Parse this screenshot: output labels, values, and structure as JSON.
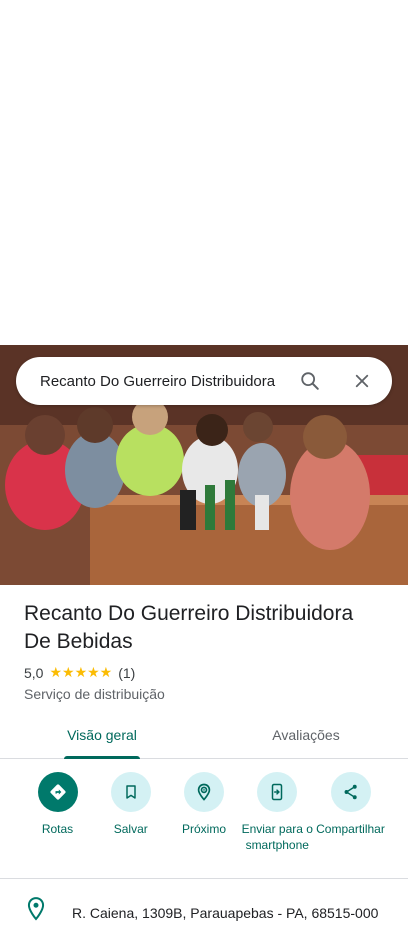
{
  "search": {
    "query": "Recanto Do Guerreiro Distribuidora"
  },
  "place": {
    "name": "Recanto Do Guerreiro Distribuidora De Bebidas",
    "rating": "5,0",
    "stars": "★★★★★",
    "review_count": "(1)",
    "category": "Serviço de distribuição"
  },
  "tabs": [
    {
      "label": "Visão geral",
      "active": true
    },
    {
      "label": "Avaliações",
      "active": false
    }
  ],
  "actions": [
    {
      "label": "Rotas",
      "icon": "directions-icon"
    },
    {
      "label": "Salvar",
      "icon": "bookmark-icon"
    },
    {
      "label": "Próximo",
      "icon": "nearby-icon"
    },
    {
      "label": "Enviar para o smartphone",
      "icon": "send-to-phone-icon"
    },
    {
      "label": "Compartilhar",
      "icon": "share-icon"
    }
  ],
  "address": "R. Caiena, 1309B, Parauapebas - PA, 68515-000",
  "colors": {
    "accent": "#00796b",
    "accent_text": "#00695c",
    "action_bg": "#d4f1f4",
    "star": "#fbbc04"
  }
}
